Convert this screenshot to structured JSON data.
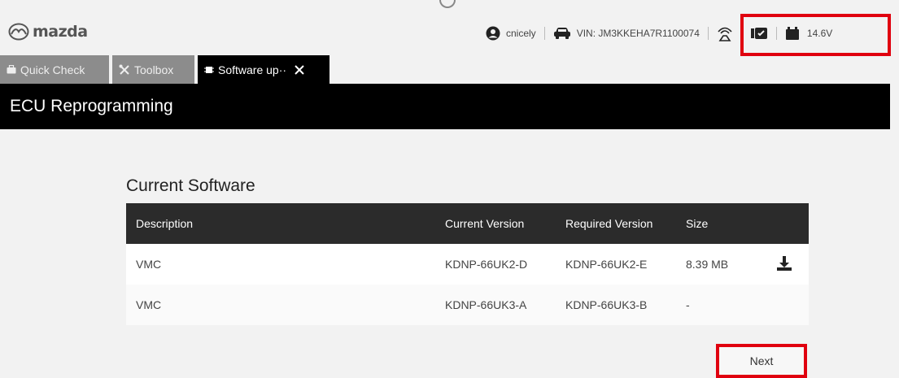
{
  "brand": {
    "logo_text": "mazda"
  },
  "status": {
    "user": "cnicely",
    "vin": "VIN: JM3KKEHA7R1100074",
    "voltage": "14.6V",
    "icons": [
      "user-icon",
      "car-icon",
      "wireless-connection-icon",
      "vci-device-icon",
      "battery-icon"
    ],
    "highlight_color": "#e0000f"
  },
  "tabs": [
    {
      "label": "Quick Check",
      "icon": "toolbox-bag-icon",
      "active": false
    },
    {
      "label": "Toolbox",
      "icon": "tools-icon",
      "active": false
    },
    {
      "label": "Software up··",
      "icon": "chip-icon",
      "active": true
    }
  ],
  "page": {
    "title": "ECU Reprogramming"
  },
  "software": {
    "title": "Current Software",
    "columns": [
      "Description",
      "Current Version",
      "Required Version",
      "Size"
    ],
    "rows": [
      {
        "description": "VMC",
        "current": "KDNP-66UK2-D",
        "required": "KDNP-66UK2-E",
        "size": "8.39 MB",
        "download_icon": "download-icon"
      },
      {
        "description": "VMC",
        "current": "KDNP-66UK3-A",
        "required": "KDNP-66UK3-B",
        "size": "-"
      }
    ]
  },
  "actions": {
    "next_label": "Next"
  }
}
